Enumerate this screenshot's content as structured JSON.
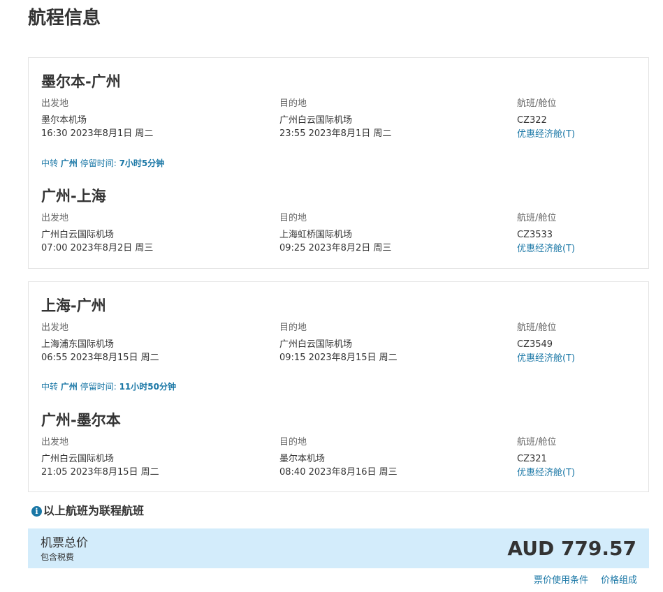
{
  "page_title": "航程信息",
  "labels": {
    "departure": "出发地",
    "arrival": "目的地",
    "flight_cabin": "航班/舱位"
  },
  "outbound": {
    "segments": [
      {
        "route": "墨尔本-广州",
        "departure_airport": "墨尔本机场",
        "departure_time": "16:30 2023年8月1日 周二",
        "arrival_airport": "广州白云国际机场",
        "arrival_time": "23:55 2023年8月1日 周二",
        "flight_no": "CZ322",
        "cabin": "优惠经济舱(T)"
      },
      {
        "route": "广州-上海",
        "departure_airport": "广州白云国际机场",
        "departure_time": "07:00 2023年8月2日 周三",
        "arrival_airport": "上海虹桥国际机场",
        "arrival_time": "09:25 2023年8月2日 周三",
        "flight_no": "CZ3533",
        "cabin": "优惠经济舱(T)"
      }
    ],
    "transfer": {
      "prefix": "中转",
      "city": "广州",
      "stay_label": "停留时间:",
      "duration": "7小时5分钟"
    }
  },
  "return": {
    "segments": [
      {
        "route": "上海-广州",
        "departure_airport": "上海浦东国际机场",
        "departure_time": "06:55 2023年8月15日 周二",
        "arrival_airport": "广州白云国际机场",
        "arrival_time": "09:15 2023年8月15日 周二",
        "flight_no": "CZ3549",
        "cabin": "优惠经济舱(T)"
      },
      {
        "route": "广州-墨尔本",
        "departure_airport": "广州白云国际机场",
        "departure_time": "21:05 2023年8月15日 周二",
        "arrival_airport": "墨尔本机场",
        "arrival_time": "08:40 2023年8月16日 周三",
        "flight_no": "CZ321",
        "cabin": "优惠经济舱(T)"
      }
    ],
    "transfer": {
      "prefix": "中转",
      "city": "广州",
      "stay_label": "停留时间:",
      "duration": "11小时50分钟"
    }
  },
  "connect_note": "以上航班为联程航班",
  "info_icon": "info-icon",
  "total": {
    "label": "机票总价",
    "sub": "包含税费",
    "price": "AUD 779.57"
  },
  "footer_links": {
    "fare_rules": "票价使用条件",
    "price_breakdown": "价格组成"
  },
  "colors": {
    "link": "#1a77a6",
    "total_bg": "#d3ecfb",
    "border": "#e3e3e3",
    "text": "#333333"
  }
}
